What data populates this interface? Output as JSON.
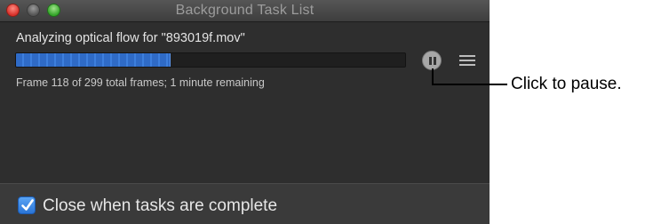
{
  "window": {
    "title": "Background Task List"
  },
  "task": {
    "name": "Analyzing optical flow for \"893019f.mov\"",
    "progress_fraction": 0.395,
    "status": "Frame 118 of 299 total frames; 1 minute remaining"
  },
  "footer": {
    "checkbox_checked": true,
    "checkbox_label": "Close when tasks are complete"
  },
  "callout": {
    "text": "Click to pause."
  },
  "colors": {
    "progress": "#3d7fdd",
    "window_bg": "#2e2e2e"
  },
  "icons": [
    "close-button",
    "minimize-button",
    "zoom-button",
    "pause-icon",
    "menu-icon",
    "checkmark-icon"
  ]
}
